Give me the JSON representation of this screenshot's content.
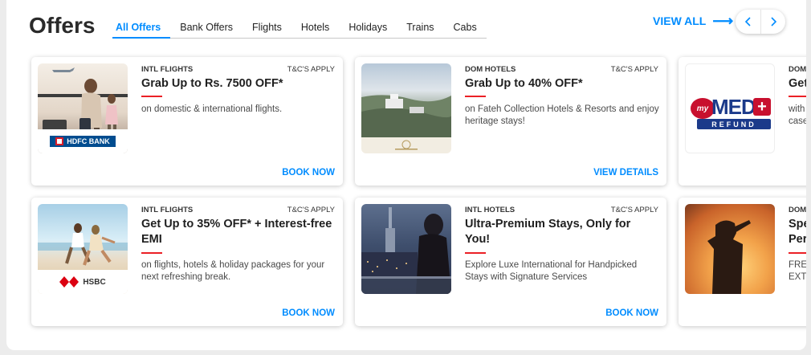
{
  "header": {
    "title": "Offers",
    "view_all": "VIEW ALL",
    "tabs": [
      {
        "label": "All Offers",
        "active": true
      },
      {
        "label": "Bank Offers",
        "active": false
      },
      {
        "label": "Flights",
        "active": false
      },
      {
        "label": "Hotels",
        "active": false
      },
      {
        "label": "Holidays",
        "active": false
      },
      {
        "label": "Trains",
        "active": false
      },
      {
        "label": "Cabs",
        "active": false
      }
    ],
    "nav_icons": [
      "chevron-left-icon",
      "chevron-right-icon"
    ]
  },
  "cards": [
    {
      "category": "INTL FLIGHTS",
      "tnc": "T&C'S APPLY",
      "headline": "Grab Up to Rs. 7500 OFF*",
      "description": "on domestic & international flights.",
      "cta": "BOOK NOW",
      "bank_label": "HDFC BANK"
    },
    {
      "category": "DOM HOTELS",
      "tnc": "T&C'S APPLY",
      "headline": "Grab Up to 40% OFF*",
      "description": "on Fateh Collection Hotels & Resorts and enjoy heritage stays!",
      "cta": "VIEW DETAILS"
    },
    {
      "category": "DOM",
      "headline": "Get",
      "description": "with case",
      "logo_text": "my",
      "logo_main": "MED",
      "logo_plus": "+",
      "logo_sub": "REFUND"
    },
    {
      "category": "INTL FLIGHTS",
      "tnc": "T&C'S APPLY",
      "headline": "Get Up to 35% OFF* + Interest-free EMI",
      "description": "on flights, hotels & holiday packages for your next refreshing break.",
      "cta": "BOOK NOW",
      "bank_label": "HSBC"
    },
    {
      "category": "INTL HOTELS",
      "tnc": "T&C'S APPLY",
      "headline": "Ultra-Premium Stays, Only for You!",
      "description": "Explore Luxe International for Handpicked Stays with Signature Services",
      "cta": "BOOK NOW"
    },
    {
      "category": "DOM",
      "headline": "Spe Per",
      "description": "FRE EXT"
    }
  ],
  "colors": {
    "accent": "#008cff",
    "divider": "#eb2026",
    "hdfc": "#004c8f",
    "hsbc": "#db0011",
    "medplus": "#c8102e"
  }
}
